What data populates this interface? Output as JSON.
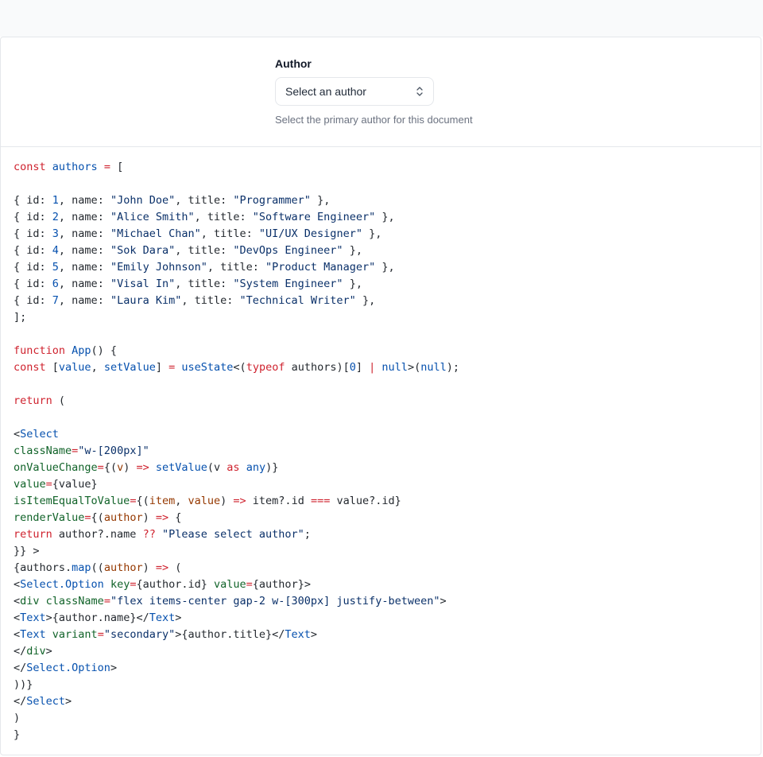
{
  "preview": {
    "label": "Author",
    "select_value": "Select an author",
    "description": "Select the primary author for this document",
    "icon": "chevron-up-down-icon"
  },
  "code_lines": [
    [
      [
        "k",
        "const "
      ],
      [
        "b",
        "authors"
      ],
      [
        "o",
        " = "
      ],
      [
        "c",
        "["
      ]
    ],
    [],
    [
      [
        "c",
        "{ id: "
      ],
      [
        "b",
        "1"
      ],
      [
        "c",
        ", name: "
      ],
      [
        "s",
        "\"John Doe\""
      ],
      [
        "c",
        ", title: "
      ],
      [
        "s",
        "\"Programmer\""
      ],
      [
        "c",
        " },"
      ]
    ],
    [
      [
        "c",
        "{ id: "
      ],
      [
        "b",
        "2"
      ],
      [
        "c",
        ", name: "
      ],
      [
        "s",
        "\"Alice Smith\""
      ],
      [
        "c",
        ", title: "
      ],
      [
        "s",
        "\"Software Engineer\""
      ],
      [
        "c",
        " },"
      ]
    ],
    [
      [
        "c",
        "{ id: "
      ],
      [
        "b",
        "3"
      ],
      [
        "c",
        ", name: "
      ],
      [
        "s",
        "\"Michael Chan\""
      ],
      [
        "c",
        ", title: "
      ],
      [
        "s",
        "\"UI/UX Designer\""
      ],
      [
        "c",
        " },"
      ]
    ],
    [
      [
        "c",
        "{ id: "
      ],
      [
        "b",
        "4"
      ],
      [
        "c",
        ", name: "
      ],
      [
        "s",
        "\"Sok Dara\""
      ],
      [
        "c",
        ", title: "
      ],
      [
        "s",
        "\"DevOps Engineer\""
      ],
      [
        "c",
        " },"
      ]
    ],
    [
      [
        "c",
        "{ id: "
      ],
      [
        "b",
        "5"
      ],
      [
        "c",
        ", name: "
      ],
      [
        "s",
        "\"Emily Johnson\""
      ],
      [
        "c",
        ", title: "
      ],
      [
        "s",
        "\"Product Manager\""
      ],
      [
        "c",
        " },"
      ]
    ],
    [
      [
        "c",
        "{ id: "
      ],
      [
        "b",
        "6"
      ],
      [
        "c",
        ", name: "
      ],
      [
        "s",
        "\"Visal In\""
      ],
      [
        "c",
        ", title: "
      ],
      [
        "s",
        "\"System Engineer\""
      ],
      [
        "c",
        " },"
      ]
    ],
    [
      [
        "c",
        "{ id: "
      ],
      [
        "b",
        "7"
      ],
      [
        "c",
        ", name: "
      ],
      [
        "s",
        "\"Laura Kim\""
      ],
      [
        "c",
        ", title: "
      ],
      [
        "s",
        "\"Technical Writer\""
      ],
      [
        "c",
        " },"
      ]
    ],
    [
      [
        "c",
        "];"
      ]
    ],
    [],
    [
      [
        "k",
        "function "
      ],
      [
        "b",
        "App"
      ],
      [
        "c",
        "() {"
      ]
    ],
    [
      [
        "k",
        "const "
      ],
      [
        "c",
        "["
      ],
      [
        "b",
        "value"
      ],
      [
        "c",
        ", "
      ],
      [
        "b",
        "setValue"
      ],
      [
        "c",
        "] "
      ],
      [
        "o",
        "= "
      ],
      [
        "b",
        "useState"
      ],
      [
        "c",
        "<("
      ],
      [
        "k",
        "typeof "
      ],
      [
        "c",
        "authors)["
      ],
      [
        "b",
        "0"
      ],
      [
        "c",
        "] "
      ],
      [
        "o",
        "| "
      ],
      [
        "b",
        "null"
      ],
      [
        "c",
        ">("
      ],
      [
        "b",
        "null"
      ],
      [
        "c",
        ");"
      ]
    ],
    [],
    [
      [
        "k",
        "return "
      ],
      [
        "c",
        "("
      ]
    ],
    [],
    [
      [
        "c",
        "<"
      ],
      [
        "b",
        "Select"
      ]
    ],
    [
      [
        "g",
        "className"
      ],
      [
        "o",
        "="
      ],
      [
        "s",
        "\"w-[200px]\""
      ]
    ],
    [
      [
        "g",
        "onValueChange"
      ],
      [
        "o",
        "="
      ],
      [
        "c",
        "{("
      ],
      [
        "p",
        "v"
      ],
      [
        "c",
        ") "
      ],
      [
        "o",
        "=> "
      ],
      [
        "b",
        "setValue"
      ],
      [
        "c",
        "(v "
      ],
      [
        "k",
        "as "
      ],
      [
        "b",
        "any"
      ],
      [
        "c",
        ")}"
      ]
    ],
    [
      [
        "g",
        "value"
      ],
      [
        "o",
        "="
      ],
      [
        "c",
        "{value}"
      ]
    ],
    [
      [
        "g",
        "isItemEqualToValue"
      ],
      [
        "o",
        "="
      ],
      [
        "c",
        "{("
      ],
      [
        "p",
        "item"
      ],
      [
        "c",
        ", "
      ],
      [
        "p",
        "value"
      ],
      [
        "c",
        ") "
      ],
      [
        "o",
        "=> "
      ],
      [
        "c",
        "item?.id "
      ],
      [
        "o",
        "=== "
      ],
      [
        "c",
        "value?.id}"
      ]
    ],
    [
      [
        "g",
        "renderValue"
      ],
      [
        "o",
        "="
      ],
      [
        "c",
        "{("
      ],
      [
        "p",
        "author"
      ],
      [
        "c",
        ") "
      ],
      [
        "o",
        "=> "
      ],
      [
        "c",
        "{"
      ]
    ],
    [
      [
        "k",
        "return "
      ],
      [
        "c",
        "author?.name "
      ],
      [
        "o",
        "?? "
      ],
      [
        "s",
        "\"Please select author\""
      ],
      [
        "c",
        ";"
      ]
    ],
    [
      [
        "c",
        "}} >"
      ]
    ],
    [
      [
        "c",
        "{authors."
      ],
      [
        "b",
        "map"
      ],
      [
        "c",
        "(("
      ],
      [
        "p",
        "author"
      ],
      [
        "c",
        ") "
      ],
      [
        "o",
        "=> "
      ],
      [
        "c",
        "("
      ]
    ],
    [
      [
        "c",
        "<"
      ],
      [
        "b",
        "Select.Option "
      ],
      [
        "g",
        "key"
      ],
      [
        "o",
        "="
      ],
      [
        "c",
        "{author.id} "
      ],
      [
        "g",
        "value"
      ],
      [
        "o",
        "="
      ],
      [
        "c",
        "{author}>"
      ]
    ],
    [
      [
        "c",
        "<"
      ],
      [
        "g",
        "div "
      ],
      [
        "g",
        "className"
      ],
      [
        "o",
        "="
      ],
      [
        "s",
        "\"flex items-center gap-2 w-[300px] justify-between\""
      ],
      [
        "c",
        ">"
      ]
    ],
    [
      [
        "c",
        "<"
      ],
      [
        "b",
        "Text"
      ],
      [
        "c",
        ">{author.name}</"
      ],
      [
        "b",
        "Text"
      ],
      [
        "c",
        ">"
      ]
    ],
    [
      [
        "c",
        "<"
      ],
      [
        "b",
        "Text "
      ],
      [
        "g",
        "variant"
      ],
      [
        "o",
        "="
      ],
      [
        "s",
        "\"secondary\""
      ],
      [
        "c",
        ">{author.title}</"
      ],
      [
        "b",
        "Text"
      ],
      [
        "c",
        ">"
      ]
    ],
    [
      [
        "c",
        "</"
      ],
      [
        "g",
        "div"
      ],
      [
        "c",
        ">"
      ]
    ],
    [
      [
        "c",
        "</"
      ],
      [
        "b",
        "Select.Option"
      ],
      [
        "c",
        ">"
      ]
    ],
    [
      [
        "c",
        "))}"
      ]
    ],
    [
      [
        "c",
        "</"
      ],
      [
        "b",
        "Select"
      ],
      [
        "c",
        ">"
      ]
    ],
    [
      [
        "c",
        ")"
      ]
    ],
    [
      [
        "c",
        "}"
      ]
    ]
  ]
}
